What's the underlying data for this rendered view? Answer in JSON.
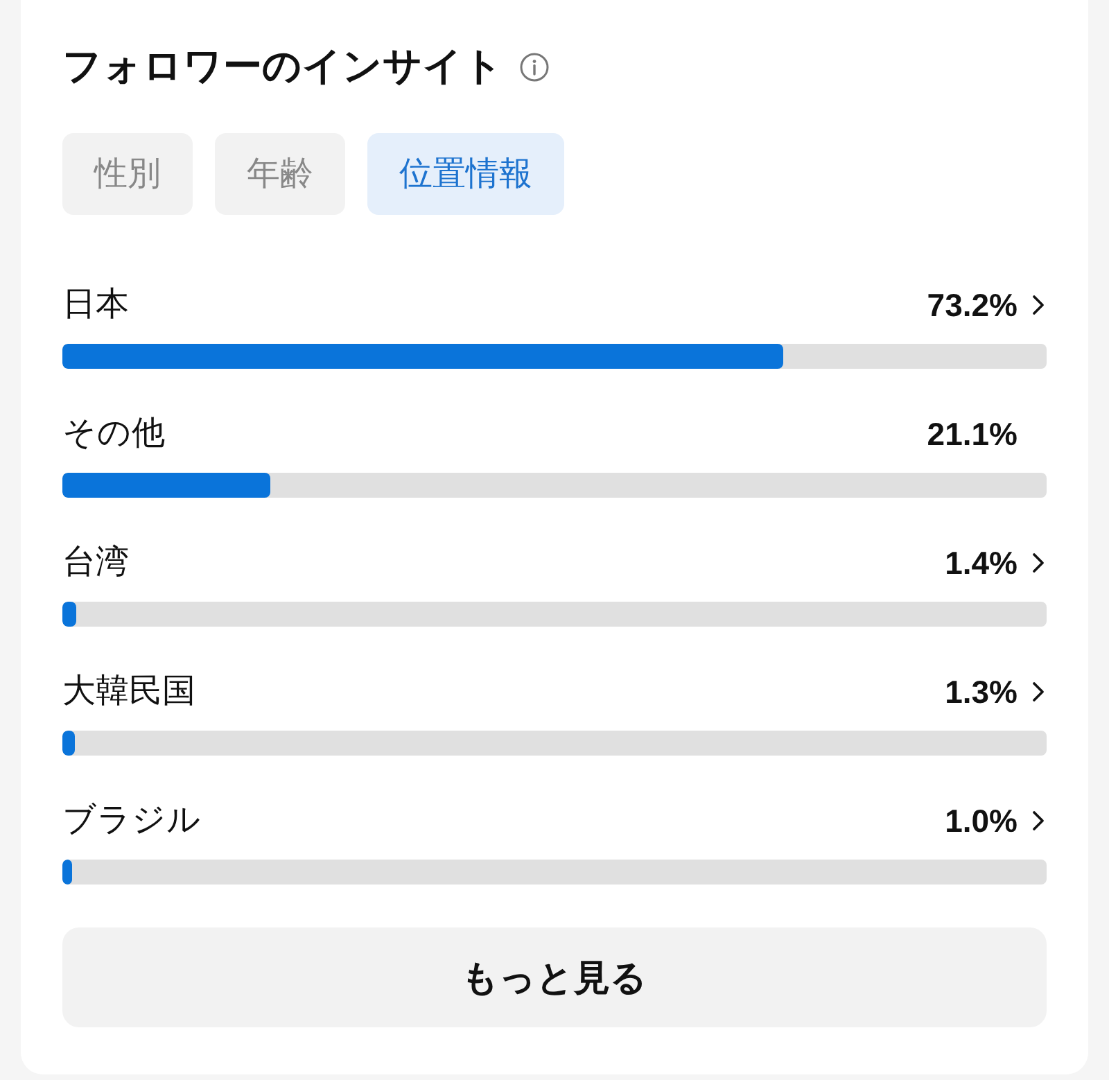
{
  "card": {
    "title": "フォロワーのインサイト"
  },
  "tabs": [
    {
      "label": "性別",
      "selected": false
    },
    {
      "label": "年齢",
      "selected": false
    },
    {
      "label": "位置情報",
      "selected": true
    }
  ],
  "regions": [
    {
      "name": "日本",
      "percent": "73.2%",
      "level": 0.732,
      "has_detail": true
    },
    {
      "name": "その他",
      "percent": "21.1%",
      "level": 0.211,
      "has_detail": false
    },
    {
      "name": "台湾",
      "percent": "1.4%",
      "level": 0.014,
      "has_detail": true
    },
    {
      "name": "大韓民国",
      "percent": "1.3%",
      "level": 0.013,
      "has_detail": true
    },
    {
      "name": "ブラジル",
      "percent": "1.0%",
      "level": 0.01,
      "has_detail": true
    }
  ],
  "more_button": {
    "label": "もっと見る"
  }
}
